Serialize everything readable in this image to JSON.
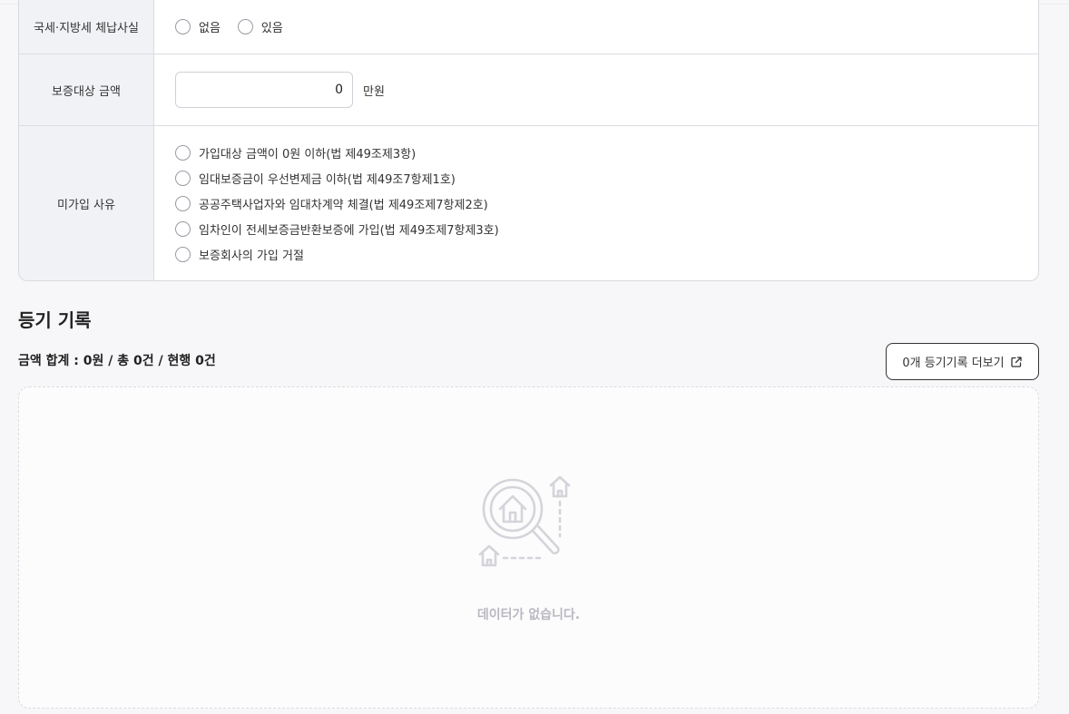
{
  "form": {
    "tax_arrears": {
      "label": "국세·지방세 체납사실",
      "options": [
        "없음",
        "있음"
      ]
    },
    "guarantee_amount": {
      "label": "보증대상 금액",
      "value": "0",
      "unit": "만원"
    },
    "non_enrollment": {
      "label": "미가입 사유",
      "options": [
        "가입대상 금액이 0원 이하(법 제49조제3항)",
        "임대보증금이 우선변제금 이하(법 제49조7항제1호)",
        "공공주택사업자와 임대차계약 체결(법 제49조제7항제2호)",
        "임차인이 전세보증금반환보증에 가입(법 제49조제7항제3호)",
        "보증회사의 가입 거절"
      ]
    }
  },
  "registry": {
    "title": "등기 기록",
    "summary": "금액 합계 : 0원 / 총 0건 / 현행 0건",
    "more_button": "0개 등기기록 더보기",
    "empty_text": "데이터가 없습니다."
  },
  "icons": {
    "more_button_icon": "external-link-icon",
    "empty_icon": "house-search-icon"
  },
  "colors": {
    "label_bg": "#f1f2f6",
    "border": "#dcdce2",
    "empty_text": "#b8b8c0"
  }
}
